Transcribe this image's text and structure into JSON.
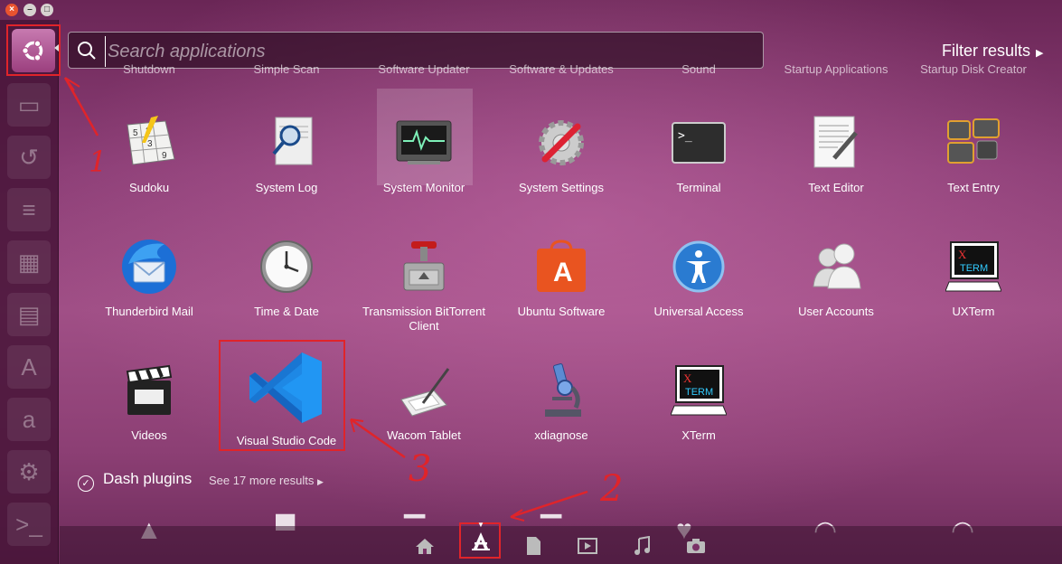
{
  "search": {
    "placeholder": "Search applications",
    "filter_label": "Filter results"
  },
  "faded_row": [
    "Shutdown",
    "Simple Scan",
    "Software Updater",
    "Software & Updates",
    "Sound",
    "Startup Applications",
    "Startup Disk Creator"
  ],
  "apps": [
    {
      "label": "Sudoku",
      "icon": "sudoku-icon"
    },
    {
      "label": "System Log",
      "icon": "system-log-icon"
    },
    {
      "label": "System Monitor",
      "icon": "system-monitor-icon"
    },
    {
      "label": "System Settings",
      "icon": "system-settings-icon"
    },
    {
      "label": "Terminal",
      "icon": "terminal-icon"
    },
    {
      "label": "Text Editor",
      "icon": "text-editor-icon"
    },
    {
      "label": "Text Entry",
      "icon": "text-entry-icon"
    },
    {
      "label": "Thunderbird Mail",
      "icon": "thunderbird-icon"
    },
    {
      "label": "Time & Date",
      "icon": "clock-icon"
    },
    {
      "label": "Transmission BitTorrent Client",
      "icon": "transmission-icon"
    },
    {
      "label": "Ubuntu Software",
      "icon": "ubuntu-software-icon"
    },
    {
      "label": "Universal Access",
      "icon": "universal-access-icon"
    },
    {
      "label": "User Accounts",
      "icon": "user-accounts-icon"
    },
    {
      "label": "UXTerm",
      "icon": "uxterm-icon"
    },
    {
      "label": "Videos",
      "icon": "videos-icon"
    },
    {
      "label": "Visual Studio Code",
      "icon": "vscode-icon"
    },
    {
      "label": "Wacom Tablet",
      "icon": "wacom-icon"
    },
    {
      "label": "xdiagnose",
      "icon": "microscope-icon"
    },
    {
      "label": "XTerm",
      "icon": "xterm-icon"
    }
  ],
  "xterm_text": {
    "x": "X",
    "term": "TERM"
  },
  "plugins": {
    "title": "Dash plugins",
    "more": "See 17 more results"
  },
  "annotations": {
    "a1": "1",
    "a2": "2",
    "a3": "3"
  },
  "colors": {
    "accent_red": "#e0242a",
    "vscode_blue": "#1e88e5",
    "ubuntu_orange": "#e95420"
  }
}
